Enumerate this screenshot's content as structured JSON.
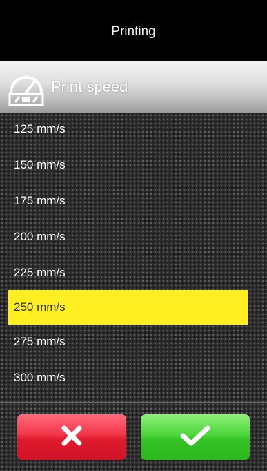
{
  "header": {
    "title": "Printing"
  },
  "section": {
    "label": "Print speed",
    "icon": "speed-gauge-icon"
  },
  "speeds": [
    "125 mm/s",
    "150 mm/s",
    "175 mm/s",
    "200 mm/s",
    "225 mm/s",
    "250 mm/s",
    "275 mm/s",
    "300 mm/s"
  ],
  "selected_value": "250 mm/s",
  "buttons": {
    "cancel_icon": "close-icon",
    "confirm_icon": "checkmark-icon",
    "cancel_color": "#e8283a",
    "confirm_color": "#3ac42a"
  },
  "colors": {
    "highlight": "#ffef22"
  }
}
